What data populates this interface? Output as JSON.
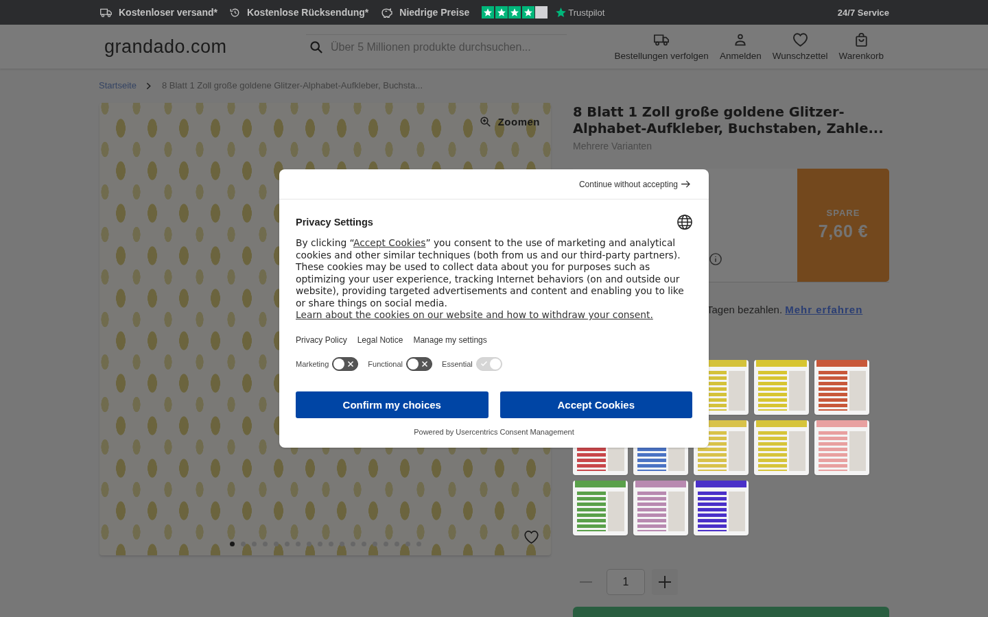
{
  "top_bar": {
    "perks": [
      {
        "kind": "shipping",
        "label": "Kostenloser versand*"
      },
      {
        "kind": "returns",
        "label": "Kostenlose Rücksendung*"
      },
      {
        "kind": "prices",
        "label": "Niedrige Preise"
      }
    ],
    "rating": {
      "stars": 4,
      "label": "Trustpilot"
    },
    "service": "24/7 Service"
  },
  "header": {
    "logo": "grandado.com",
    "search": {
      "placeholder": "Über 5 Millionen produkte durchsuchen..."
    },
    "nav": [
      {
        "kind": "orders",
        "label": "Bestellungen verfolgen"
      },
      {
        "kind": "account",
        "label": "Anmelden"
      },
      {
        "kind": "wishlist",
        "label": "Wunschzettel"
      },
      {
        "kind": "cart",
        "label": "Warenkorb"
      }
    ]
  },
  "breadcrumb": [
    {
      "label": "Startseite",
      "current": false
    },
    {
      "label": "8 Blatt 1 Zoll große goldene Glitzer-Alphabet-Aufkleber, Buchsta...",
      "current": true
    }
  ],
  "gallery": {
    "zoom_label": "Zoomen",
    "dots": [
      {
        "selected": true
      },
      {
        "selected": false
      },
      {
        "selected": false
      },
      {
        "selected": false
      },
      {
        "selected": false
      },
      {
        "selected": false
      },
      {
        "selected": false
      },
      {
        "selected": false
      },
      {
        "selected": false
      },
      {
        "selected": false
      },
      {
        "selected": false
      },
      {
        "selected": false
      },
      {
        "selected": false
      },
      {
        "selected": false
      },
      {
        "selected": false
      },
      {
        "selected": false
      },
      {
        "selected": false
      },
      {
        "selected": false
      }
    ]
  },
  "product": {
    "title": "8 Blatt 1 Zoll große goldene Glitzer-Alphabet-Aufkleber, Buchstaben, Zahle...",
    "subtitle": "Mehrere Varianten",
    "saving": {
      "label": "SPARE",
      "amount": "7,60 €"
    },
    "payment": {
      "text": "Tagen bezahlen.",
      "link": "Mehr erfahren"
    },
    "variants": [
      {
        "color": "#d4c23a"
      },
      {
        "color": "#d7c531"
      },
      {
        "color": "#c8583a"
      },
      {
        "color": "#c8464a"
      },
      {
        "color": "#4a72c4"
      },
      {
        "color": "#d8c24a"
      },
      {
        "color": "#d6c43a"
      },
      {
        "color": "#e8a0a0"
      },
      {
        "color": "#5aa04a"
      },
      {
        "color": "#b889b0"
      },
      {
        "color": "#4a30c8"
      }
    ],
    "quantity": {
      "value": "1",
      "decrease_disabled": true
    }
  },
  "consent": {
    "dismiss": "Continue without accepting",
    "title": "Privacy Settings",
    "body": [
      {
        "kind": "text",
        "text": "By clicking “"
      },
      {
        "kind": "link",
        "text": "Accept Cookies"
      },
      {
        "kind": "text",
        "text": "” you consent to the use of marketing and analytical cookies and other similar techniques (both from us and our third-party partners). These cookies may be used to collect data about you for purposes such as optimizing your user experience, tracking Internet behaviors (on and outside our website), providing targeted advertisements and content and enabling you to like or share things on social media. "
      },
      {
        "kind": "link",
        "text": "Learn about the cookies on our website and how to withdraw your consent."
      }
    ],
    "links": [
      "Privacy Policy",
      "Legal Notice",
      "Manage my settings"
    ],
    "toggles": [
      {
        "label": "Marketing",
        "on": false,
        "disabled": false
      },
      {
        "label": "Functional",
        "on": false,
        "disabled": false
      },
      {
        "label": "Essential",
        "on": true,
        "disabled": true
      }
    ],
    "buttons": [
      "Confirm my choices",
      "Accept Cookies"
    ],
    "footer": "Powered by Usercentrics Consent Management"
  }
}
